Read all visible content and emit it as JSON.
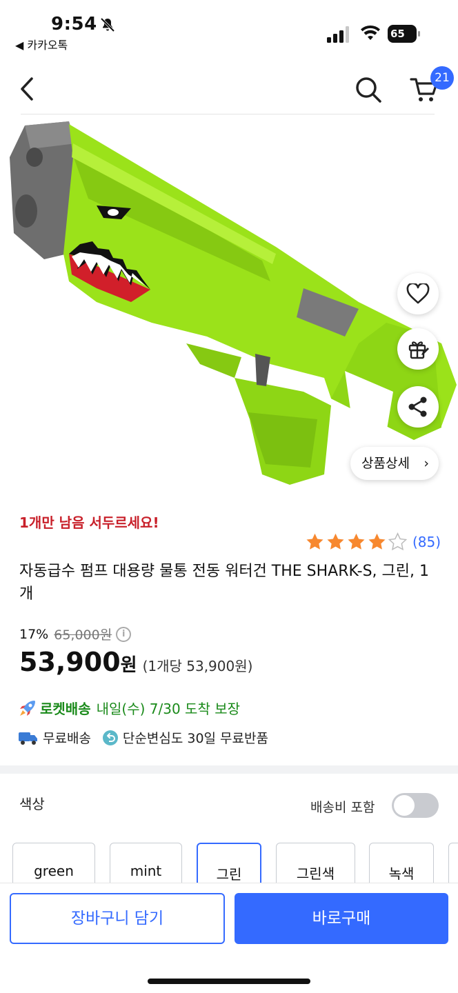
{
  "status_bar": {
    "time": "9:54",
    "back_app": "◀ 카카오톡",
    "battery": "65"
  },
  "nav": {
    "cart_count": "21"
  },
  "product": {
    "urgent_text": "1개만 남음 서두르세요!",
    "rating": 4,
    "review_count": "(85)",
    "title": "자동급수 펌프 대용량 물통 전동 워터건 THE SHARK-S, 그린, 1개",
    "discount_rate": "17%",
    "original_price": "65,000원",
    "price": "53,900",
    "price_unit": "원",
    "unit_price": "(1개당 53,900원)",
    "detail_button": "상품상세",
    "detail_chevron": "›"
  },
  "delivery": {
    "rocket_label": "로켓배송",
    "rocket_date": "내일(수) 7/30 도착 보장",
    "free_shipping": "무료배송",
    "free_return": "단순변심도 30일 무료반품"
  },
  "options": {
    "color_label": "색상",
    "shipping_toggle_label": "배송비 포함",
    "shipping_toggle_on": false,
    "chips": [
      "green",
      "mint",
      "그린",
      "그린색",
      "녹색"
    ],
    "selected_chip": "그린"
  },
  "bottom_bar": {
    "add_to_cart": "장바구니 담기",
    "buy_now": "바로구매"
  },
  "colors": {
    "accent": "#346aff",
    "urgent": "#c8202a",
    "rocket": "#1a8a1a",
    "star": "#f7882f",
    "product_green": "#9be21a"
  },
  "icons": [
    "bell-slash-icon",
    "signal-icon",
    "wifi-icon",
    "battery-icon",
    "back-icon",
    "search-icon",
    "cart-icon",
    "heart-icon",
    "gift-icon",
    "share-icon",
    "star-icon",
    "info-icon",
    "rocket-icon",
    "truck-icon",
    "return-icon"
  ]
}
